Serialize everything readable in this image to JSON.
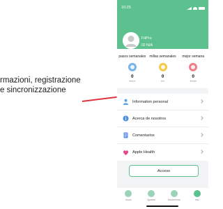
{
  "annotation": {
    "line1": "rmazioni, registrazione",
    "line2": "e sincronizzazione"
  },
  "statusbar": {
    "time": "10:25"
  },
  "profile": {
    "name": "FitPro",
    "id": "ID N/A"
  },
  "stats": [
    {
      "label": "pasos semanales",
      "value": "0",
      "unit": "steps",
      "icon": "footprints-icon",
      "color": "#79b4ea"
    },
    {
      "label": "millas semanales",
      "value": "0",
      "unit": "km",
      "icon": "distance-icon",
      "color": "#f2c94c"
    },
    {
      "label": "mejor semana",
      "value": "0",
      "unit": "steps",
      "icon": "trophy-icon",
      "color": "#ef7f86"
    }
  ],
  "menu": [
    {
      "label": "Information personal",
      "icon": "person-icon",
      "color": "#5aa3e8"
    },
    {
      "label": "Acerca de nosotros",
      "icon": "info-icon",
      "color": "#4a90e2"
    },
    {
      "label": "Comentarios",
      "icon": "document-icon",
      "color": "#5b8def"
    },
    {
      "label": "Apple Health",
      "icon": "health-heart-icon",
      "color": "#e6478a"
    }
  ],
  "login": {
    "label": "Acceso"
  },
  "tabs": [
    {
      "label": "Inicio",
      "icon": "home-icon",
      "color": "#9ad3b8"
    },
    {
      "label": "Ajustes",
      "icon": "settings-icon",
      "color": "#9ad3b8"
    },
    {
      "label": "Movimiento",
      "icon": "activity-icon",
      "color": "#9ad3b8"
    },
    {
      "label": "mio",
      "icon": "profile-icon",
      "color": "#5dc08f"
    }
  ]
}
